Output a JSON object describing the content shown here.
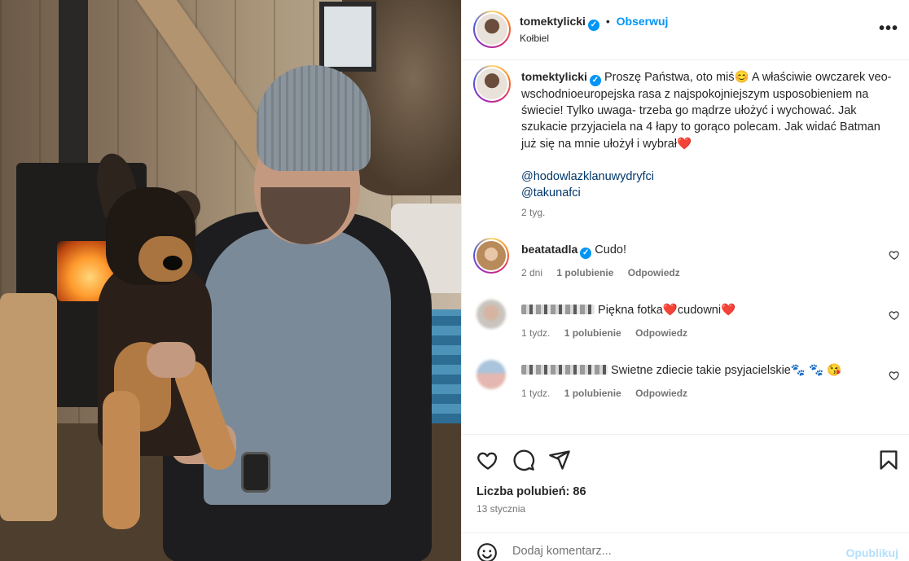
{
  "post_author": {
    "username": "tomektylicki",
    "separator": "•",
    "follow_label": "Obserwuj",
    "location": "Kołbiel"
  },
  "caption": {
    "username": "tomektylicki",
    "text": "Proszę Państwa, oto miś😊 A właściwie owczarek veo- wschodnioeuropejska rasa z najspokojniejszym usposobieniem na świecie! Tylko uwaga- trzeba go mądrze ułożyć i wychować. Jak szukacie przyjaciela na 4 łapy to gorąco polecam. Jak widać Batman już się na mnie ułożył i wybrał❤️",
    "mentions": [
      "@hodowlazklanuwydryfci",
      "@takunafci"
    ],
    "time": "2 tyg."
  },
  "comments": [
    {
      "username": "beatatadla",
      "verified": true,
      "text": "Cudo!",
      "time": "2 dni",
      "likes": "1 polubienie",
      "reply": "Odpowiedz"
    },
    {
      "username": "",
      "text": "Piękna fotka❤️cudowni❤️",
      "time": "1 tydz.",
      "likes": "1 polubienie",
      "reply": "Odpowiedz"
    },
    {
      "username": "",
      "text": "Swietne zdiecie takie psyjacielskie🐾 🐾 😘",
      "time": "1 tydz.",
      "likes": "1 polubienie",
      "reply": "Odpowiedz"
    }
  ],
  "actions": {
    "icons": [
      "heart-icon",
      "comment-icon",
      "share-icon",
      "bookmark-icon"
    ]
  },
  "likes_text": "Liczba polubień: 86",
  "date": "13 stycznia",
  "add_comment": {
    "placeholder": "Dodaj komentarz...",
    "publish_label": "Opublikuj"
  },
  "colors": {
    "accent": "#0095f6",
    "text": "#262626",
    "muted": "#737373",
    "link": "#00376b",
    "publish_disabled": "#b2dffc",
    "heart": "#e0245e"
  }
}
